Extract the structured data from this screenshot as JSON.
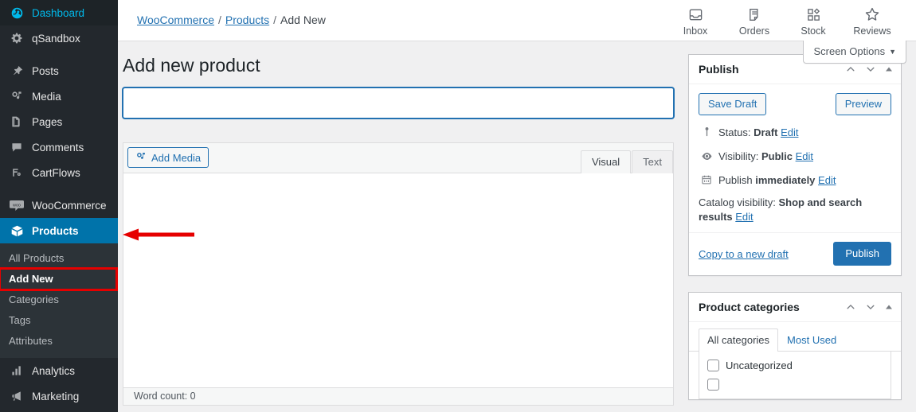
{
  "sidebar": {
    "items": [
      {
        "label": "Dashboard",
        "icon": "dashboard-icon",
        "state": "current"
      },
      {
        "label": "qSandbox",
        "icon": "gear-icon",
        "state": "normal"
      },
      {
        "label": "Posts",
        "icon": "pin-icon",
        "state": "normal"
      },
      {
        "label": "Media",
        "icon": "media-icon",
        "state": "normal"
      },
      {
        "label": "Pages",
        "icon": "pages-icon",
        "state": "normal"
      },
      {
        "label": "Comments",
        "icon": "comment-icon",
        "state": "normal"
      },
      {
        "label": "CartFlows",
        "icon": "cartflows-icon",
        "state": "normal"
      },
      {
        "label": "WooCommerce",
        "icon": "woo-icon",
        "state": "normal"
      },
      {
        "label": "Products",
        "icon": "products-box-icon",
        "state": "active"
      },
      {
        "label": "Analytics",
        "icon": "analytics-icon",
        "state": "normal"
      },
      {
        "label": "Marketing",
        "icon": "marketing-megaphone-icon",
        "state": "normal"
      }
    ],
    "submenu": [
      {
        "label": "All Products",
        "highlight": false
      },
      {
        "label": "Add New",
        "highlight": true
      },
      {
        "label": "Categories",
        "highlight": false
      },
      {
        "label": "Tags",
        "highlight": false
      },
      {
        "label": "Attributes",
        "highlight": false
      }
    ]
  },
  "topbar": {
    "breadcrumb": {
      "root": "WooCommerce",
      "parent": "Products",
      "current": "Add New",
      "separator": "/"
    },
    "nav": [
      {
        "label": "Inbox",
        "icon": "inbox-icon"
      },
      {
        "label": "Orders",
        "icon": "orders-document-icon"
      },
      {
        "label": "Stock",
        "icon": "stock-grid-icon"
      },
      {
        "label": "Reviews",
        "icon": "star-icon"
      }
    ],
    "screen_options": {
      "label": "Screen Options",
      "caret": "▼"
    }
  },
  "main": {
    "page_title": "Add new product",
    "title_input": {
      "value": "",
      "placeholder": ""
    },
    "editor": {
      "add_media_label": "Add Media",
      "tabs": [
        {
          "label": "Visual",
          "active": true
        },
        {
          "label": "Text",
          "active": false
        }
      ],
      "body_text": "",
      "word_count": "Word count: 0"
    }
  },
  "publish_panel": {
    "title": "Publish",
    "save_draft_label": "Save Draft",
    "preview_label": "Preview",
    "status": {
      "prefix": "Status:",
      "value": "Draft",
      "edit": "Edit",
      "icon": "pin-status-icon"
    },
    "visibility": {
      "prefix": "Visibility:",
      "value": "Public",
      "edit": "Edit",
      "icon": "eye-icon"
    },
    "schedule": {
      "prefix": "Publish",
      "value": "immediately",
      "edit": "Edit",
      "icon": "calendar-icon"
    },
    "catalog_visibility": {
      "prefix": "Catalog visibility:",
      "value": "Shop and search results",
      "edit": "Edit"
    },
    "copy_draft_label": "Copy to a new draft",
    "publish_label": "Publish"
  },
  "categories_panel": {
    "title": "Product categories",
    "tabs": [
      {
        "label": "All categories",
        "active": true
      },
      {
        "label": "Most Used",
        "active": false
      }
    ],
    "items": [
      {
        "label": "Uncategorized",
        "checked": false
      },
      {
        "label": "",
        "checked": false
      }
    ]
  },
  "annotation": {
    "arrow_color": "#e60000",
    "highlight_box_color": "#e60000"
  },
  "colors": {
    "sidebar_bg": "#23282d",
    "submenu_bg": "#2c3338",
    "active_blue": "#0073aa",
    "link_blue": "#2271b1",
    "primary_button": "#2271b1"
  }
}
